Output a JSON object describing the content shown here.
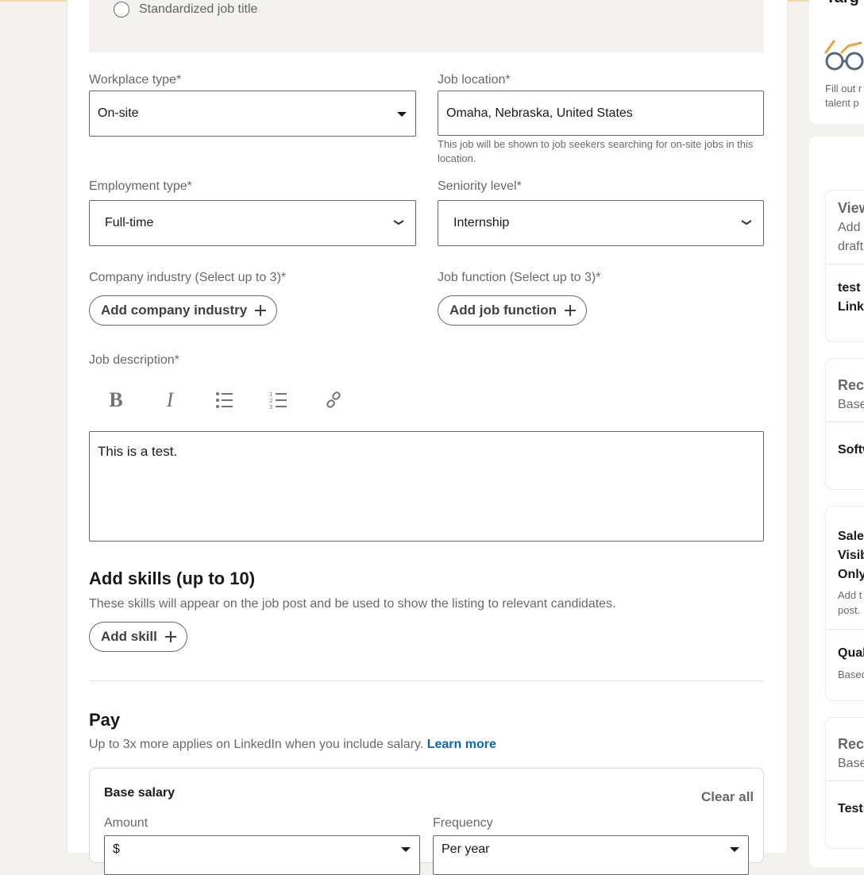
{
  "form": {
    "standardized_option": "Standardized job title",
    "workplace_type": {
      "label": "Workplace type*",
      "value": "On-site"
    },
    "job_location": {
      "label": "Job location*",
      "value": "Omaha, Nebraska, United States",
      "helper": "This job will be shown to job seekers searching for on-site jobs in this location."
    },
    "employment_type": {
      "label": "Employment type*",
      "value": "Full-time"
    },
    "seniority_level": {
      "label": "Seniority level*",
      "value": "Internship"
    },
    "company_industry": {
      "label": "Company industry (Select up to 3)*",
      "button": "Add company industry"
    },
    "job_function": {
      "label": "Job function (Select up to 3)*",
      "button": "Add job function"
    },
    "job_description": {
      "label": "Job description*",
      "value": "This is a test."
    },
    "skills": {
      "title": "Add skills (up to 10)",
      "subtitle": "These skills will appear on the job post and be used to show the listing to relevant candidates.",
      "button": "Add skill"
    },
    "pay": {
      "title": "Pay",
      "subtitle": "Up to 3x more applies on LinkedIn when you include salary.",
      "learn_more": "Learn more"
    },
    "base_salary": {
      "title": "Base salary",
      "clear_all": "Clear all",
      "amount_label": "Amount",
      "amount_value": "$",
      "frequency_label": "Frequency",
      "frequency_value": "Per year"
    }
  },
  "sidebar": {
    "top_title": "Targ",
    "top_desc_1": "Fill out r",
    "top_desc_2": "talent p",
    "views": {
      "title": "View",
      "desc_1": "Add",
      "desc_2": "draft",
      "item_1": "test",
      "item_2": "Linke"
    },
    "rec1": {
      "title": "Reco",
      "desc": "Base",
      "item": "Softw"
    },
    "sales": {
      "line_1": "Sales",
      "line_2": "Visib",
      "line_3": "Only",
      "desc_1": "Add t",
      "desc_2": "post.",
      "item": "Qual",
      "item_desc": "Based"
    },
    "rec2": {
      "title": "Reco",
      "desc": "Base",
      "item": "Testi"
    }
  }
}
